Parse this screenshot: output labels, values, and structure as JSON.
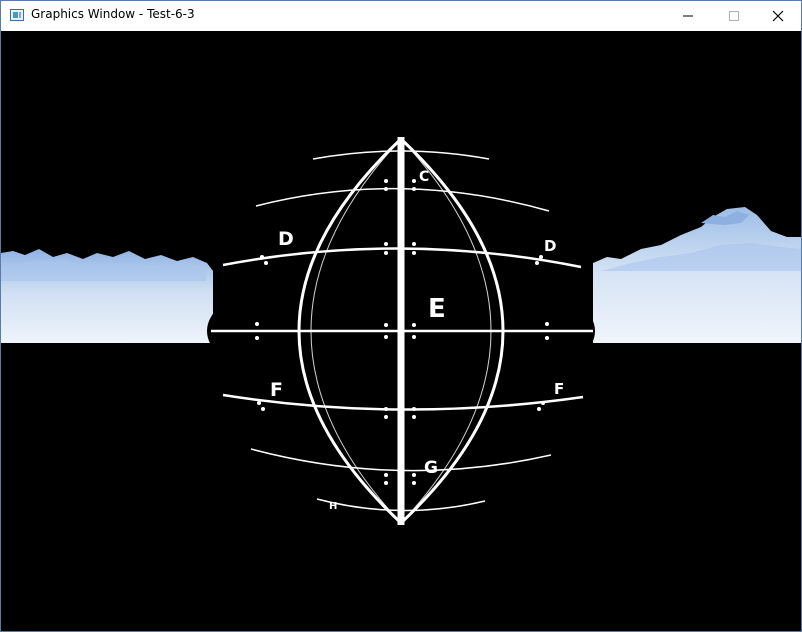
{
  "window": {
    "title": "Graphics Window - Test-6-3",
    "icon": "graphics-window-app-icon",
    "controls": [
      "minimize",
      "maximize",
      "close"
    ]
  },
  "scene": {
    "background_color": "#000000",
    "sky_color": "#b8d4ee",
    "grid_color": "#ffffff",
    "labels": {
      "c": "C",
      "d_left": "D",
      "d_right": "D",
      "e": "E",
      "f_left": "F",
      "f_right": "F",
      "g": "G",
      "h": "H"
    }
  }
}
